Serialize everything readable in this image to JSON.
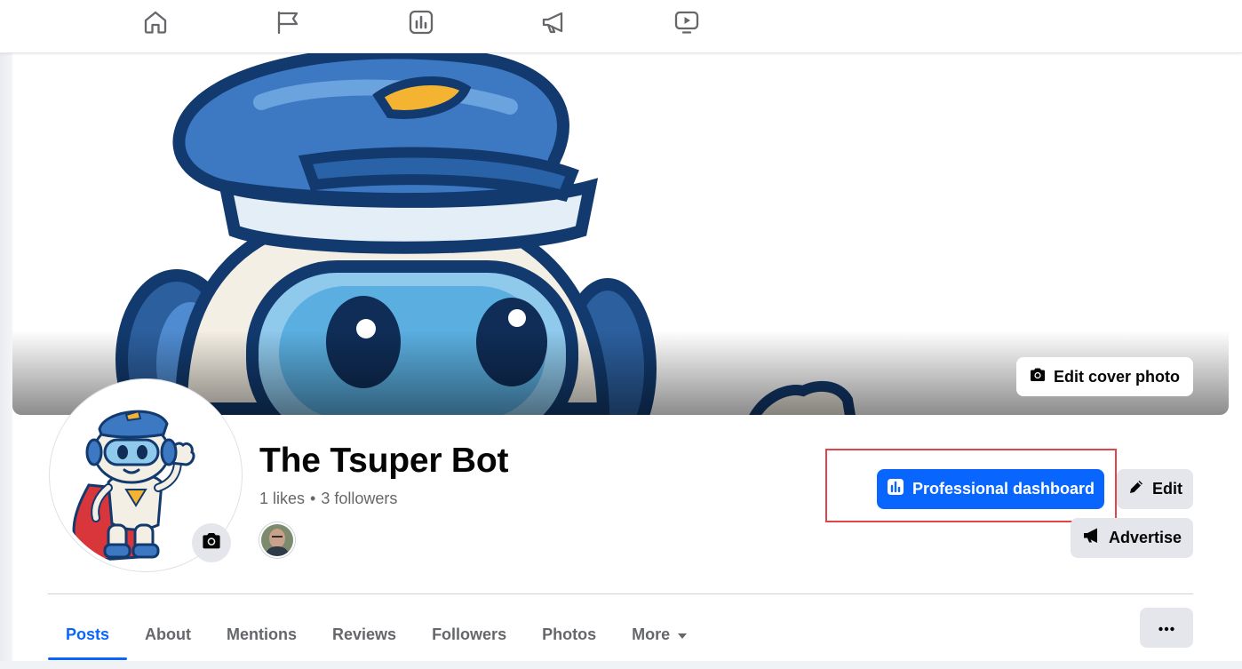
{
  "nav": {
    "icons": [
      "home-icon",
      "flag-icon",
      "insights-icon",
      "megaphone-icon",
      "video-icon"
    ]
  },
  "cover": {
    "edit_label": "Edit cover photo"
  },
  "page": {
    "name": "The Tsuper Bot",
    "likes": "1 likes",
    "separator": "•",
    "followers": "3 followers"
  },
  "actions": {
    "professional_dashboard": "Professional dashboard",
    "edit": "Edit",
    "advertise": "Advertise"
  },
  "tabs": [
    {
      "label": "Posts",
      "active": true
    },
    {
      "label": "About"
    },
    {
      "label": "Mentions"
    },
    {
      "label": "Reviews"
    },
    {
      "label": "Followers"
    },
    {
      "label": "Photos"
    },
    {
      "label": "More"
    }
  ],
  "colors": {
    "accent": "#0866ff",
    "secondary_button": "#e4e6eb",
    "muted_text": "#65676b",
    "highlight_box": "#e0454a"
  }
}
